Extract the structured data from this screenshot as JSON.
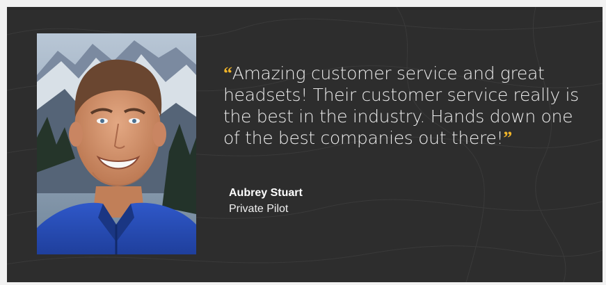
{
  "testimonial": {
    "open_quote": "“",
    "quote": "Amazing customer service and great headsets! Their customer service really is the best in the industry. Hands down one of the best companies out there!",
    "close_quote": "”",
    "author_name": "Aubrey Stuart",
    "author_title": "Private Pilot"
  },
  "colors": {
    "card_background": "#2d2d2d",
    "quote_mark": "#f0b429",
    "text": "#ececec"
  }
}
